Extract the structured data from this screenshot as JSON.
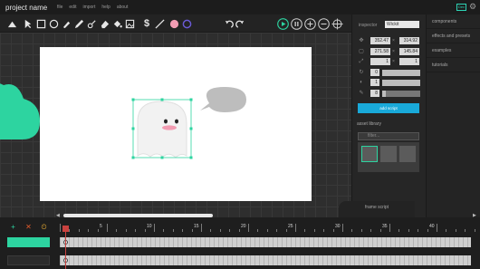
{
  "menu": {
    "project_name": "project name",
    "items": [
      "file",
      "edit",
      "import",
      "help",
      "about"
    ],
    "badge": "Dev"
  },
  "toolbar": {
    "tools": [
      "select-icon",
      "rectangle-icon",
      "ellipse-icon",
      "brush-icon",
      "pencil-icon",
      "path-icon",
      "eraser-icon",
      "bucket-icon",
      "text-icon",
      "dollar-icon",
      "line-icon",
      "fill-color-icon",
      "stroke-color-icon"
    ],
    "fill_color": "#f29cb2",
    "stroke_color": "#6a5ad6",
    "playback": [
      "play-icon",
      "pause-icon",
      "add-icon",
      "remove-icon",
      "crosshair-icon"
    ]
  },
  "inspector": {
    "title": "inspector",
    "object_type": "Wickit",
    "position": {
      "x": "352.47",
      "y": "314.92"
    },
    "size": {
      "w": "271.58",
      "h": "145.84"
    },
    "scale": {
      "x": "1",
      "y": "1"
    },
    "rotation": "0",
    "opacity": "1",
    "frame": "8",
    "rotation_level": 1.0,
    "opacity_level": 1.0,
    "frame_level": 0.1,
    "add_script_label": "add script"
  },
  "asset_library": {
    "title": "asset library",
    "filter_placeholder": "filter..."
  },
  "right_tabs": [
    "components",
    "effects and presets",
    "examples",
    "tutorials"
  ],
  "frame_script_label": "frame script",
  "timeline": {
    "frame_numbers": [
      "5",
      "10",
      "15",
      "20",
      "25",
      "30",
      "35",
      "40"
    ],
    "layer_colors": [
      "#2dd4a0",
      "#2b2b2b"
    ],
    "controls": [
      "add-layer-icon",
      "delete-layer-icon",
      "onion-skin-icon"
    ]
  },
  "colors": {
    "accent_teal": "#2dd4a0",
    "accent_orange": "#e05a2b",
    "accent_blue": "#19a9d9"
  }
}
